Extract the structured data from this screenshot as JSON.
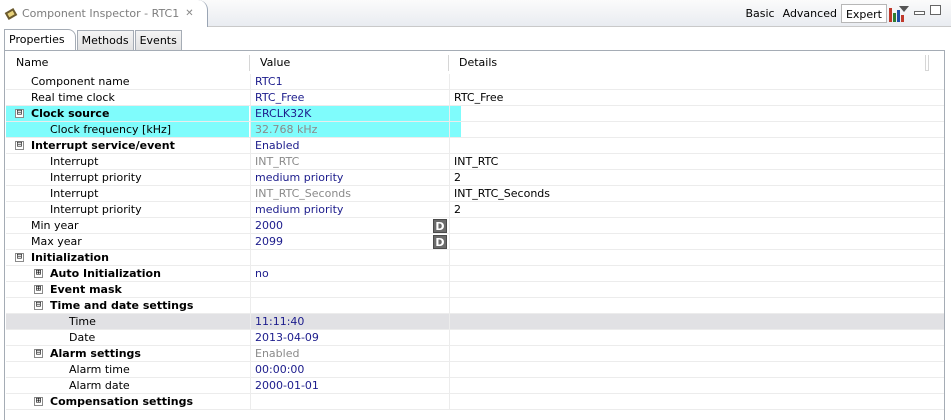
{
  "view": {
    "title": "Component Inspector - RTC1",
    "close_icon": "close-icon",
    "modes": [
      "Basic",
      "Advanced",
      "Expert"
    ],
    "active_mode": "Expert",
    "accent": "#7ffcfc"
  },
  "subtabs": [
    "Properties",
    "Methods",
    "Events"
  ],
  "active_subtab": "Properties",
  "columns": [
    "Name",
    "Value",
    "Details"
  ],
  "rows": [
    {
      "name": "Component name",
      "value": "RTC1",
      "details": ""
    },
    {
      "name": "Real time clock",
      "value": "RTC_Free",
      "details": "RTC_Free"
    },
    {
      "name": "Clock source",
      "value": "ERCLK32K",
      "details": ""
    },
    {
      "name": "Clock frequency [kHz]",
      "value": "32.768 kHz",
      "details": ""
    },
    {
      "name": "Interrupt service/event",
      "value": "Enabled",
      "details": ""
    },
    {
      "name": "Interrupt",
      "value": "INT_RTC",
      "details": "INT_RTC"
    },
    {
      "name": "Interrupt priority",
      "value": "medium priority",
      "details": "2"
    },
    {
      "name": "Interrupt",
      "value": "INT_RTC_Seconds",
      "details": "INT_RTC_Seconds"
    },
    {
      "name": "Interrupt priority",
      "value": "medium priority",
      "details": "2"
    },
    {
      "name": "Min year",
      "value": "2000",
      "details": "",
      "button": "D"
    },
    {
      "name": "Max year",
      "value": "2099",
      "details": "",
      "button": "D"
    },
    {
      "name": "Initialization",
      "value": "",
      "details": ""
    },
    {
      "name": "Auto Initialization",
      "value": "no",
      "details": ""
    },
    {
      "name": "Event mask",
      "value": "",
      "details": ""
    },
    {
      "name": "Time and date settings",
      "value": "",
      "details": ""
    },
    {
      "name": "Time",
      "value": "11:11:40",
      "details": ""
    },
    {
      "name": "Date",
      "value": "2013-04-09",
      "details": ""
    },
    {
      "name": "Alarm settings",
      "value": "Enabled",
      "details": ""
    },
    {
      "name": "Alarm time",
      "value": "00:00:00",
      "details": ""
    },
    {
      "name": "Alarm date",
      "value": "2000-01-01",
      "details": ""
    },
    {
      "name": "Compensation settings",
      "value": "",
      "details": ""
    }
  ],
  "expanders": {
    "expanded": "⊟",
    "collapsed": "⊞"
  }
}
